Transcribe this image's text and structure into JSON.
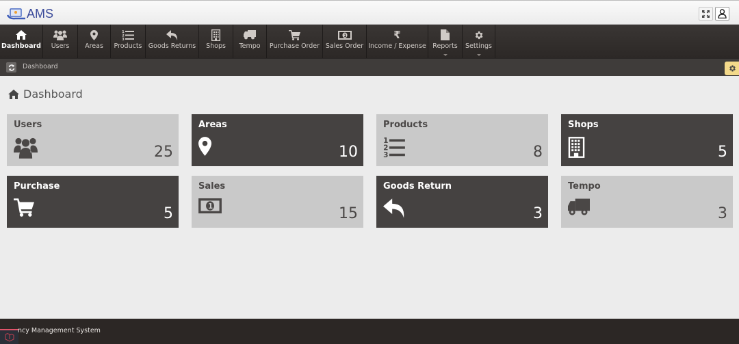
{
  "app": {
    "title": "AMS",
    "footer_text": "ncy Management System"
  },
  "topbar": {
    "expand_icon": "expand-icon",
    "user_icon": "user-icon"
  },
  "nav": [
    {
      "label": "Dashboard",
      "icon": "home-icon",
      "active": true
    },
    {
      "label": "Users",
      "icon": "users-icon"
    },
    {
      "label": "Areas",
      "icon": "map-marker-icon"
    },
    {
      "label": "Products",
      "icon": "ordered-list-icon"
    },
    {
      "label": "Goods Returns",
      "icon": "reply-icon"
    },
    {
      "label": "Shops",
      "icon": "building-icon"
    },
    {
      "label": "Tempo",
      "icon": "truck-icon"
    },
    {
      "label": "Purchase Order",
      "icon": "cart-icon"
    },
    {
      "label": "Sales Order",
      "icon": "money-icon"
    },
    {
      "label": "Income / Expense",
      "icon": "rupee-icon"
    },
    {
      "label": "Reports",
      "icon": "file-icon",
      "dropdown": true
    },
    {
      "label": "Settings",
      "icon": "gear-icon",
      "dropdown": true
    }
  ],
  "breadcrumb": {
    "current": "Dashboard"
  },
  "page": {
    "title": "Dashboard"
  },
  "cards": [
    {
      "title": "Users",
      "count": "25",
      "icon": "users-icon",
      "theme": "light"
    },
    {
      "title": "Areas",
      "count": "10",
      "icon": "map-marker-icon",
      "theme": "dark"
    },
    {
      "title": "Products",
      "count": "8",
      "icon": "ordered-list-icon",
      "theme": "light"
    },
    {
      "title": "Shops",
      "count": "5",
      "icon": "building-icon",
      "theme": "dark"
    },
    {
      "title": "Purchase",
      "count": "5",
      "icon": "cart-icon",
      "theme": "dark"
    },
    {
      "title": "Sales",
      "count": "15",
      "icon": "money-icon",
      "theme": "light"
    },
    {
      "title": "Goods Return",
      "count": "3",
      "icon": "reply-icon",
      "theme": "dark"
    },
    {
      "title": "Tempo",
      "count": "3",
      "icon": "truck-icon",
      "theme": "light"
    }
  ],
  "colors": {
    "nav_bg": "#2f2b29",
    "card_dark": "#454241",
    "card_light": "#c9c9c9",
    "accent_yellow": "#f3d98a",
    "logo_blue": "#3a4a9a"
  }
}
